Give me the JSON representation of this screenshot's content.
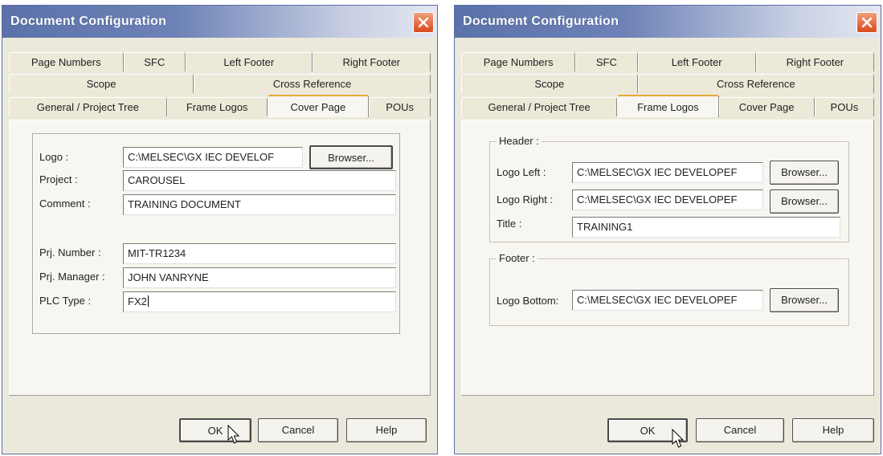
{
  "dialogs": [
    {
      "title": "Document Configuration",
      "tabs": {
        "row1": [
          "Page Numbers",
          "SFC",
          "Left Footer",
          "Right Footer"
        ],
        "row2": [
          "Scope",
          "Cross Reference"
        ],
        "row3": [
          "General / Project Tree",
          "Frame Logos",
          "Cover Page",
          "POUs"
        ]
      },
      "active_tab": "Cover Page",
      "cover_page": {
        "logo_label": "Logo :",
        "logo_value": "C:\\MELSEC\\GX IEC DEVELOF",
        "browse_label": "Browser...",
        "project_label": "Project :",
        "project_value": "CAROUSEL",
        "comment_label": "Comment :",
        "comment_value": "TRAINING DOCUMENT",
        "prj_number_label": "Prj. Number :",
        "prj_number_value": "MIT-TR1234",
        "prj_manager_label": "Prj. Manager :",
        "prj_manager_value": "JOHN VANRYNE",
        "plc_type_label": "PLC Type :",
        "plc_type_value": "FX2"
      },
      "buttons": {
        "ok": "OK",
        "cancel": "Cancel",
        "help": "Help"
      }
    },
    {
      "title": "Document Configuration",
      "tabs": {
        "row1": [
          "Page Numbers",
          "SFC",
          "Left Footer",
          "Right Footer"
        ],
        "row2": [
          "Scope",
          "Cross Reference"
        ],
        "row3": [
          "General / Project Tree",
          "Frame Logos",
          "Cover Page",
          "POUs"
        ]
      },
      "active_tab": "Frame Logos",
      "frame_logos": {
        "header_legend": "Header :",
        "logo_left_label": "Logo Left :",
        "logo_left_value": "C:\\MELSEC\\GX IEC DEVELOPEF",
        "logo_right_label": "Logo Right :",
        "logo_right_value": "C:\\MELSEC\\GX IEC DEVELOPEF",
        "title_label": "Title :",
        "title_value": "TRAINING1",
        "footer_legend": "Footer :",
        "logo_bottom_label": "Logo Bottom:",
        "logo_bottom_value": "C:\\MELSEC\\GX IEC DEVELOPEF",
        "browse_label": "Browser..."
      },
      "buttons": {
        "ok": "OK",
        "cancel": "Cancel",
        "help": "Help"
      }
    }
  ],
  "colors": {
    "titlebar_start": "#5b72a9",
    "titlebar_end": "#e4e7f1",
    "dialog_bg": "#ebe9db",
    "close_button": "#d94a1c",
    "active_tab_accent": "#e7a83a"
  },
  "icons": {
    "close": "close-icon",
    "cursor": "mouse-pointer-icon"
  }
}
